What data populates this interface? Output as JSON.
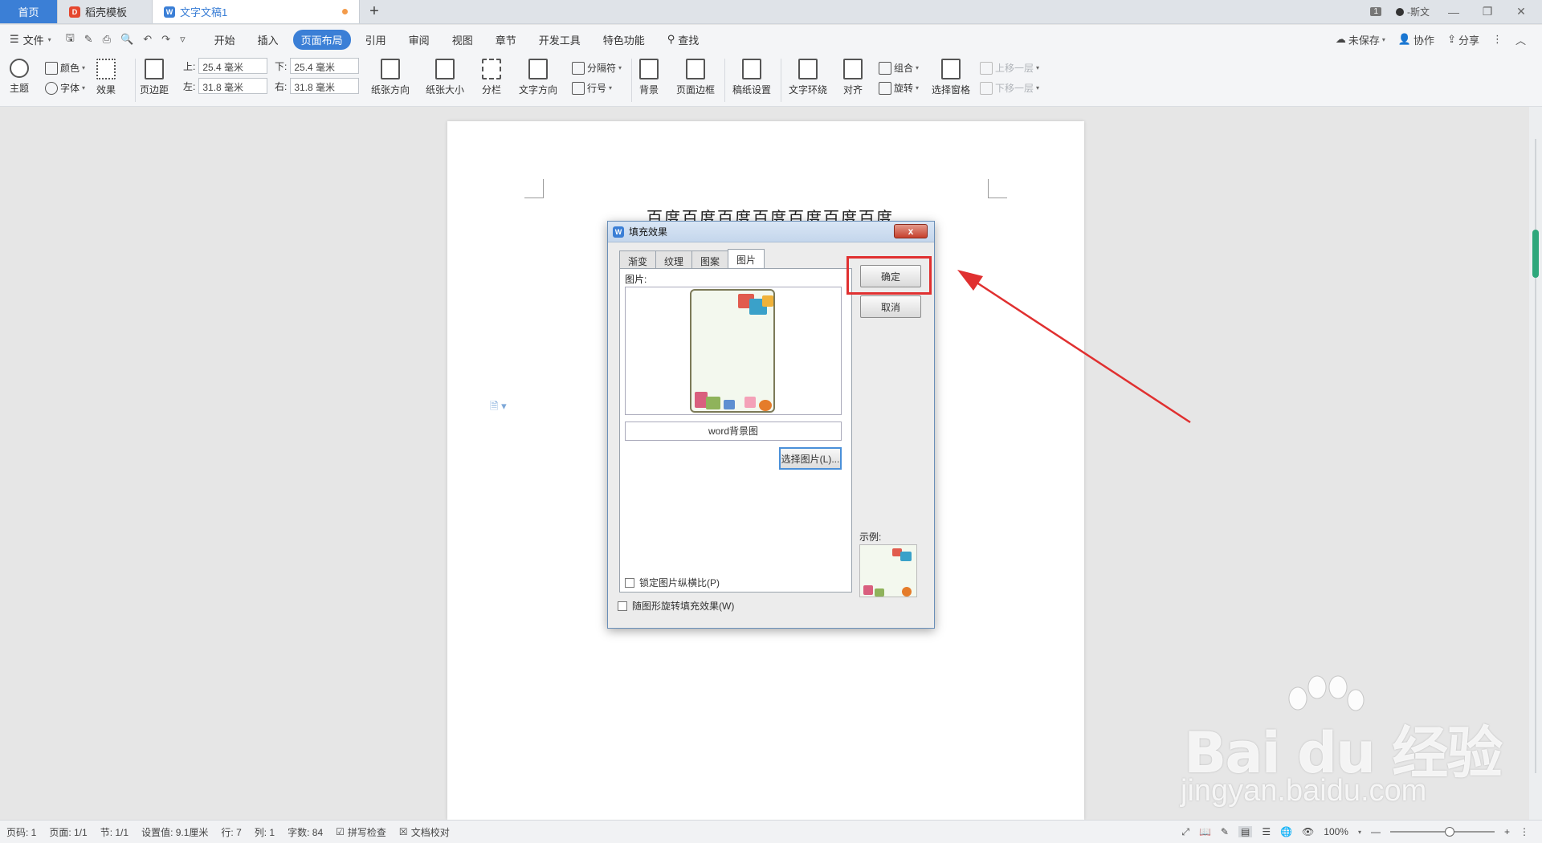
{
  "tabs": {
    "home": "首页",
    "template": "稻壳模板",
    "document": "文字文稿1",
    "add": "+"
  },
  "titlebar": {
    "page_badge": "1",
    "user": "-斯文"
  },
  "menu": {
    "file": "文件",
    "items": [
      "开始",
      "插入",
      "页面布局",
      "引用",
      "审阅",
      "视图",
      "章节",
      "开发工具",
      "特色功能"
    ],
    "active": "页面布局",
    "search": "查找",
    "unsaved": "未保存",
    "collab": "协作",
    "share": "分享"
  },
  "ribbon": {
    "theme": "主题",
    "color": "颜色",
    "font": "字体",
    "effect": "效果",
    "margin": "页边距",
    "top_label": "上:",
    "top_value": "25.4 毫米",
    "bottom_label": "下:",
    "bottom_value": "25.4 毫米",
    "left_label": "左:",
    "left_value": "31.8 毫米",
    "right_label": "右:",
    "right_value": "31.8 毫米",
    "orientation": "纸张方向",
    "size": "纸张大小",
    "columns": "分栏",
    "text_direction": "文字方向",
    "separator": "分隔符",
    "line_number": "行号",
    "background": "背景",
    "border": "页面边框",
    "manuscript": "稿纸设置",
    "wrap": "文字环绕",
    "align": "对齐",
    "group": "组合",
    "rotate": "旋转",
    "selection_pane": "选择窗格",
    "bring_forward": "上移一层",
    "send_backward": "下移一层"
  },
  "document": {
    "title_text": "百度百度百度百度百度百度百度"
  },
  "dialog": {
    "title": "填充效果",
    "close": "x",
    "tabs": [
      "渐变",
      "纹理",
      "图案",
      "图片"
    ],
    "active_tab": "图片",
    "picture_label": "图片:",
    "picture_name": "word背景图",
    "select_button": "选择图片(L)...",
    "lock_ratio": "锁定图片纵横比(P)",
    "rotate_with_shape": "随图形旋转填充效果(W)",
    "ok": "确定",
    "cancel": "取消",
    "sample_label": "示例:"
  },
  "status": {
    "page_no": "页码: 1",
    "pages": "页面: 1/1",
    "section": "节: 1/1",
    "setting": "设置值: 9.1厘米",
    "row": "行: 7",
    "col": "列: 1",
    "words": "字数: 84",
    "spell": "拼写检查",
    "proof": "文档校对",
    "zoom": "100%"
  },
  "watermark": {
    "big": "Bai du 经验",
    "small": "jingyan.baidu.com"
  },
  "colors": {
    "accent": "#3b7fd6",
    "highlight_red": "#e03030",
    "scroll_green": "#2ea77b"
  }
}
